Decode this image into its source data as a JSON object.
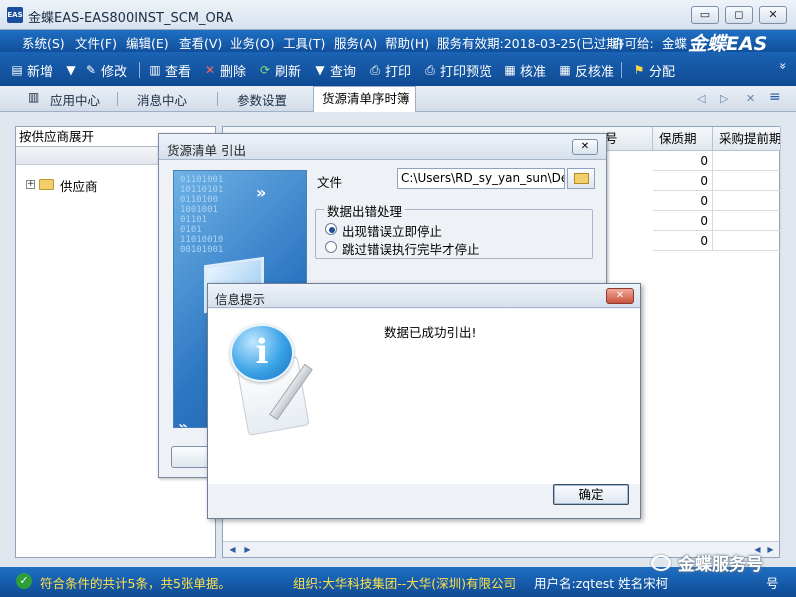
{
  "window": {
    "title": "金蝶EAS-EAS800INST_SCM_ORA",
    "logo_text": "EAS",
    "minimize_glyph": "▭",
    "maximize_glyph": "◻",
    "close_glyph": "✕"
  },
  "menubar": {
    "items": [
      "系统(S)",
      "文件(F)",
      "编辑(E)",
      "查看(V)",
      "业务(O)",
      "工具(T)",
      "服务(A)",
      "帮助(H)"
    ],
    "expiry": "服务有效期:2018-03-25(已过期)",
    "license": "许可给:",
    "license_user": "金蝶",
    "brand": "金蝶EAS"
  },
  "toolbar": {
    "items": [
      {
        "label": "新增",
        "icon": "new-doc-icon",
        "glyph": "▤"
      },
      {
        "label": "修改",
        "icon": "edit-brush-icon",
        "glyph": "✎"
      },
      {
        "label": "查看",
        "icon": "view-icon",
        "glyph": "▥"
      },
      {
        "label": "删除",
        "icon": "delete-x-icon",
        "glyph": "✕"
      },
      {
        "label": "刷新",
        "icon": "refresh-icon",
        "glyph": "⟳"
      },
      {
        "label": "查询",
        "icon": "filter-icon",
        "glyph": "▼"
      },
      {
        "label": "打印",
        "icon": "print-icon",
        "glyph": "⎙"
      },
      {
        "label": "打印预览",
        "icon": "print-preview-icon",
        "glyph": "⎙"
      },
      {
        "label": "核准",
        "icon": "approve-icon",
        "glyph": "▦"
      },
      {
        "label": "反核准",
        "icon": "unapprove-icon",
        "glyph": "▦"
      },
      {
        "label": "分配",
        "icon": "assign-icon",
        "glyph": "⚑"
      }
    ],
    "dropdown_glyph": "▼",
    "more_glyph": "»"
  },
  "tabs": {
    "items": [
      "应用中心",
      "消息中心",
      "参数设置"
    ],
    "active": "货源清单序时簿",
    "nav_prev": "◁",
    "nav_next": "▷",
    "nav_close": "✕",
    "nav_menu": "≡"
  },
  "left_panel": {
    "combo_value": "按供应商展开",
    "tree_root": "供应商",
    "expander": "+"
  },
  "grid": {
    "headers": [
      "号",
      "保质期",
      "采购提前期"
    ],
    "rows": [
      [
        "0"
      ],
      [
        "0"
      ],
      [
        "0"
      ],
      [
        "0"
      ],
      [
        "0"
      ]
    ]
  },
  "import_dialog": {
    "title": "货源清单 引出",
    "close_glyph": "✕",
    "file_label": "文件",
    "file_value": "C:\\Users\\RD_sy_yan_sun\\Des",
    "group_title": "数据出错处理",
    "option_stop": "出现错误立即停止",
    "option_skip": "跳过错误执行完毕才停止",
    "art_binary": "01101001\n10110101\n0110100\n1001001\n01101\n0101\n11010010\n00101001",
    "art_arrows": "»"
  },
  "info_dialog": {
    "title": "信息提示",
    "close_glyph": "✕",
    "icon_glyph": "i",
    "message": "数据已成功引出!",
    "ok_label": "确定"
  },
  "statusbar": {
    "ok_glyph": "✓",
    "text": "符合条件的共计5条，共5张单据。",
    "org": "组织:大华科技集团--大华(深圳)有限公司",
    "user": "用户名:zqtest 姓名宋柯",
    "extra": "号"
  },
  "watermark": "金蝶服务号",
  "colors": {
    "menubar": "#1565b8",
    "status_text": "#ffe04a"
  }
}
